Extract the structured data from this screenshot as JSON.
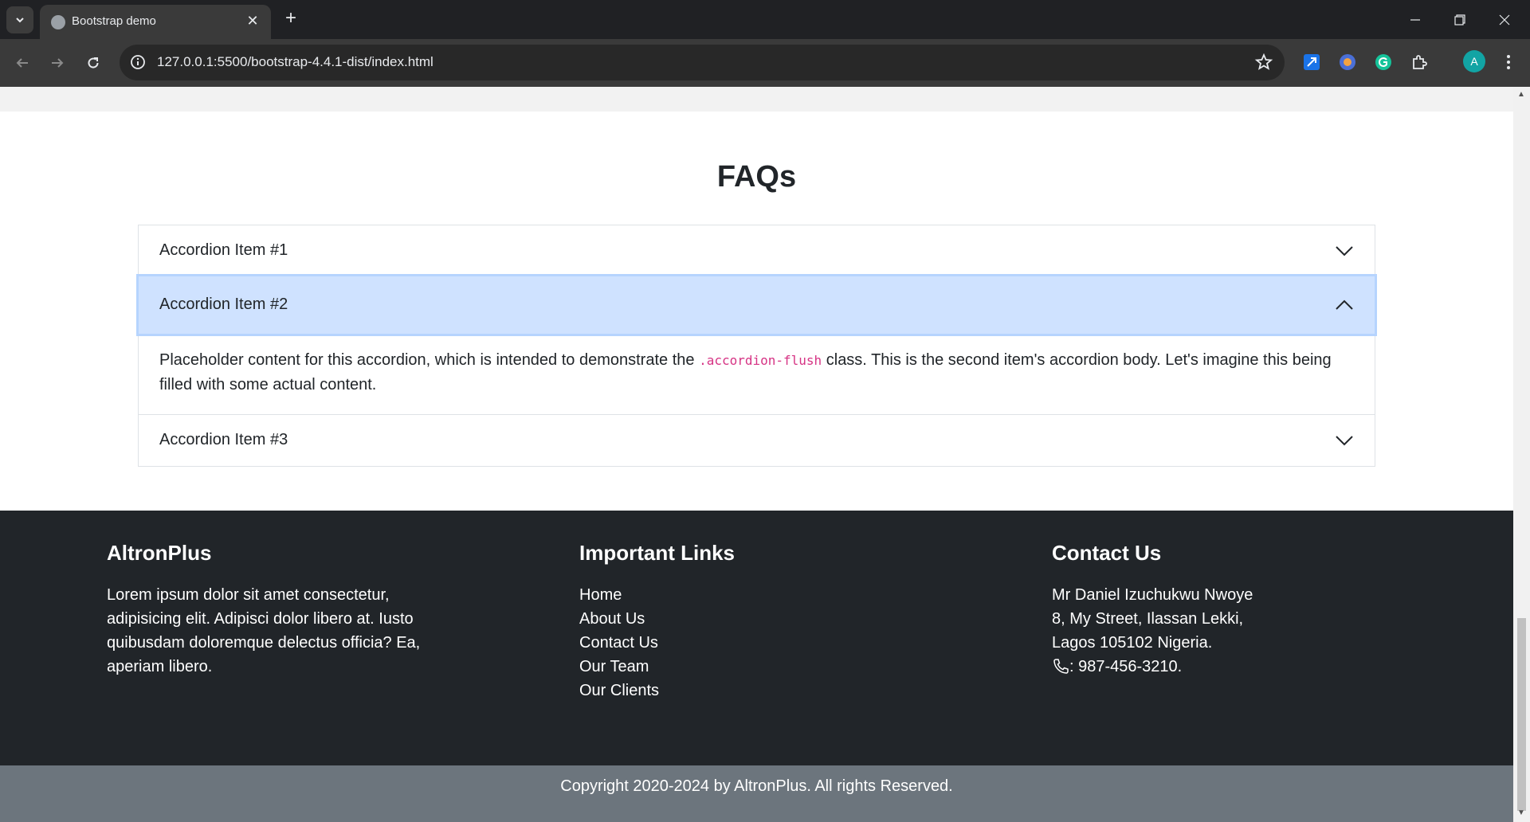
{
  "browser": {
    "tab_title": "Bootstrap demo",
    "url": "127.0.0.1:5500/bootstrap-4.4.1-dist/index.html",
    "avatar_letter": "A"
  },
  "faq": {
    "title": "FAQs",
    "items": [
      {
        "label": "Accordion Item #1",
        "expanded": false
      },
      {
        "label": "Accordion Item #2",
        "expanded": true,
        "body_before": "Placeholder content for this accordion, which is intended to demonstrate the ",
        "body_code": ".accordion-flush",
        "body_after": " class. This is the second item's accordion body. Let's imagine this being filled with some actual content."
      },
      {
        "label": "Accordion Item #3",
        "expanded": false
      }
    ]
  },
  "footer": {
    "brand": {
      "title": "AltronPlus",
      "text": "Lorem ipsum dolor sit amet consectetur, adipisicing elit. Adipisci dolor libero at. Iusto quibusdam doloremque delectus officia? Ea, aperiam libero."
    },
    "links": {
      "title": "Important Links",
      "items": [
        "Home",
        "About Us",
        "Contact Us",
        "Our Team",
        "Our Clients"
      ]
    },
    "contact": {
      "title": "Contact Us",
      "name": "Mr Daniel Izuchukwu Nwoye",
      "address1": "8, My Street, Ilassan Lekki,",
      "address2": "Lagos 105102 Nigeria.",
      "phone": ": 987-456-3210."
    },
    "copyright": "Copyright 2020-2024 by AltronPlus. All rights Reserved."
  }
}
